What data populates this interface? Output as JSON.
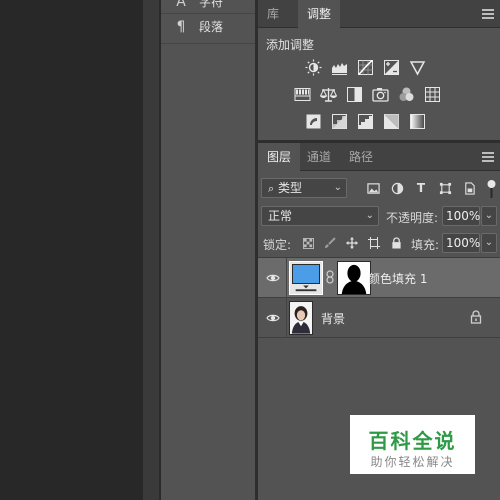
{
  "character_panel": {
    "items": [
      {
        "icon": "type-tool-icon",
        "label": "字符"
      },
      {
        "icon": "pilcrow-icon",
        "label": "段落"
      }
    ]
  },
  "top_panel": {
    "tabs": [
      {
        "label": "库",
        "active": false
      },
      {
        "label": "调整",
        "active": true
      }
    ],
    "title": "添加调整",
    "icons_row1": [
      "brightness-contrast-icon",
      "levels-icon",
      "curves-icon",
      "exposure-icon",
      "vibrance-icon"
    ],
    "icons_row2": [
      "hue-saturation-icon",
      "color-balance-icon",
      "black-white-icon",
      "photo-filter-icon",
      "channel-mixer-icon",
      "color-lookup-icon"
    ],
    "icons_row3": [
      "invert-icon",
      "posterize-icon",
      "threshold-icon",
      "selective-color-icon",
      "gradient-map-icon"
    ]
  },
  "layers_panel": {
    "tabs": [
      {
        "label": "图层",
        "active": true
      },
      {
        "label": "通道",
        "active": false
      },
      {
        "label": "路径",
        "active": false
      }
    ],
    "filter_label": "类型",
    "blend_mode": "正常",
    "opacity_label": "不透明度:",
    "opacity_value": "100%",
    "lock_label": "锁定:",
    "fill_label": "填充:",
    "fill_value": "100%",
    "layers": [
      {
        "name": "颜色填充 1",
        "selected": true,
        "thumb_color": "#4a9de6"
      },
      {
        "name": "背景",
        "selected": false,
        "locked": true
      }
    ]
  },
  "watermark": {
    "title": "百科全说",
    "subtitle": "助你轻松解决"
  },
  "colors": {
    "panel_bg": "#535353",
    "tab_bg": "#424242",
    "fill_layer": "#4a9de6",
    "watermark_green": "#2e9a46"
  }
}
